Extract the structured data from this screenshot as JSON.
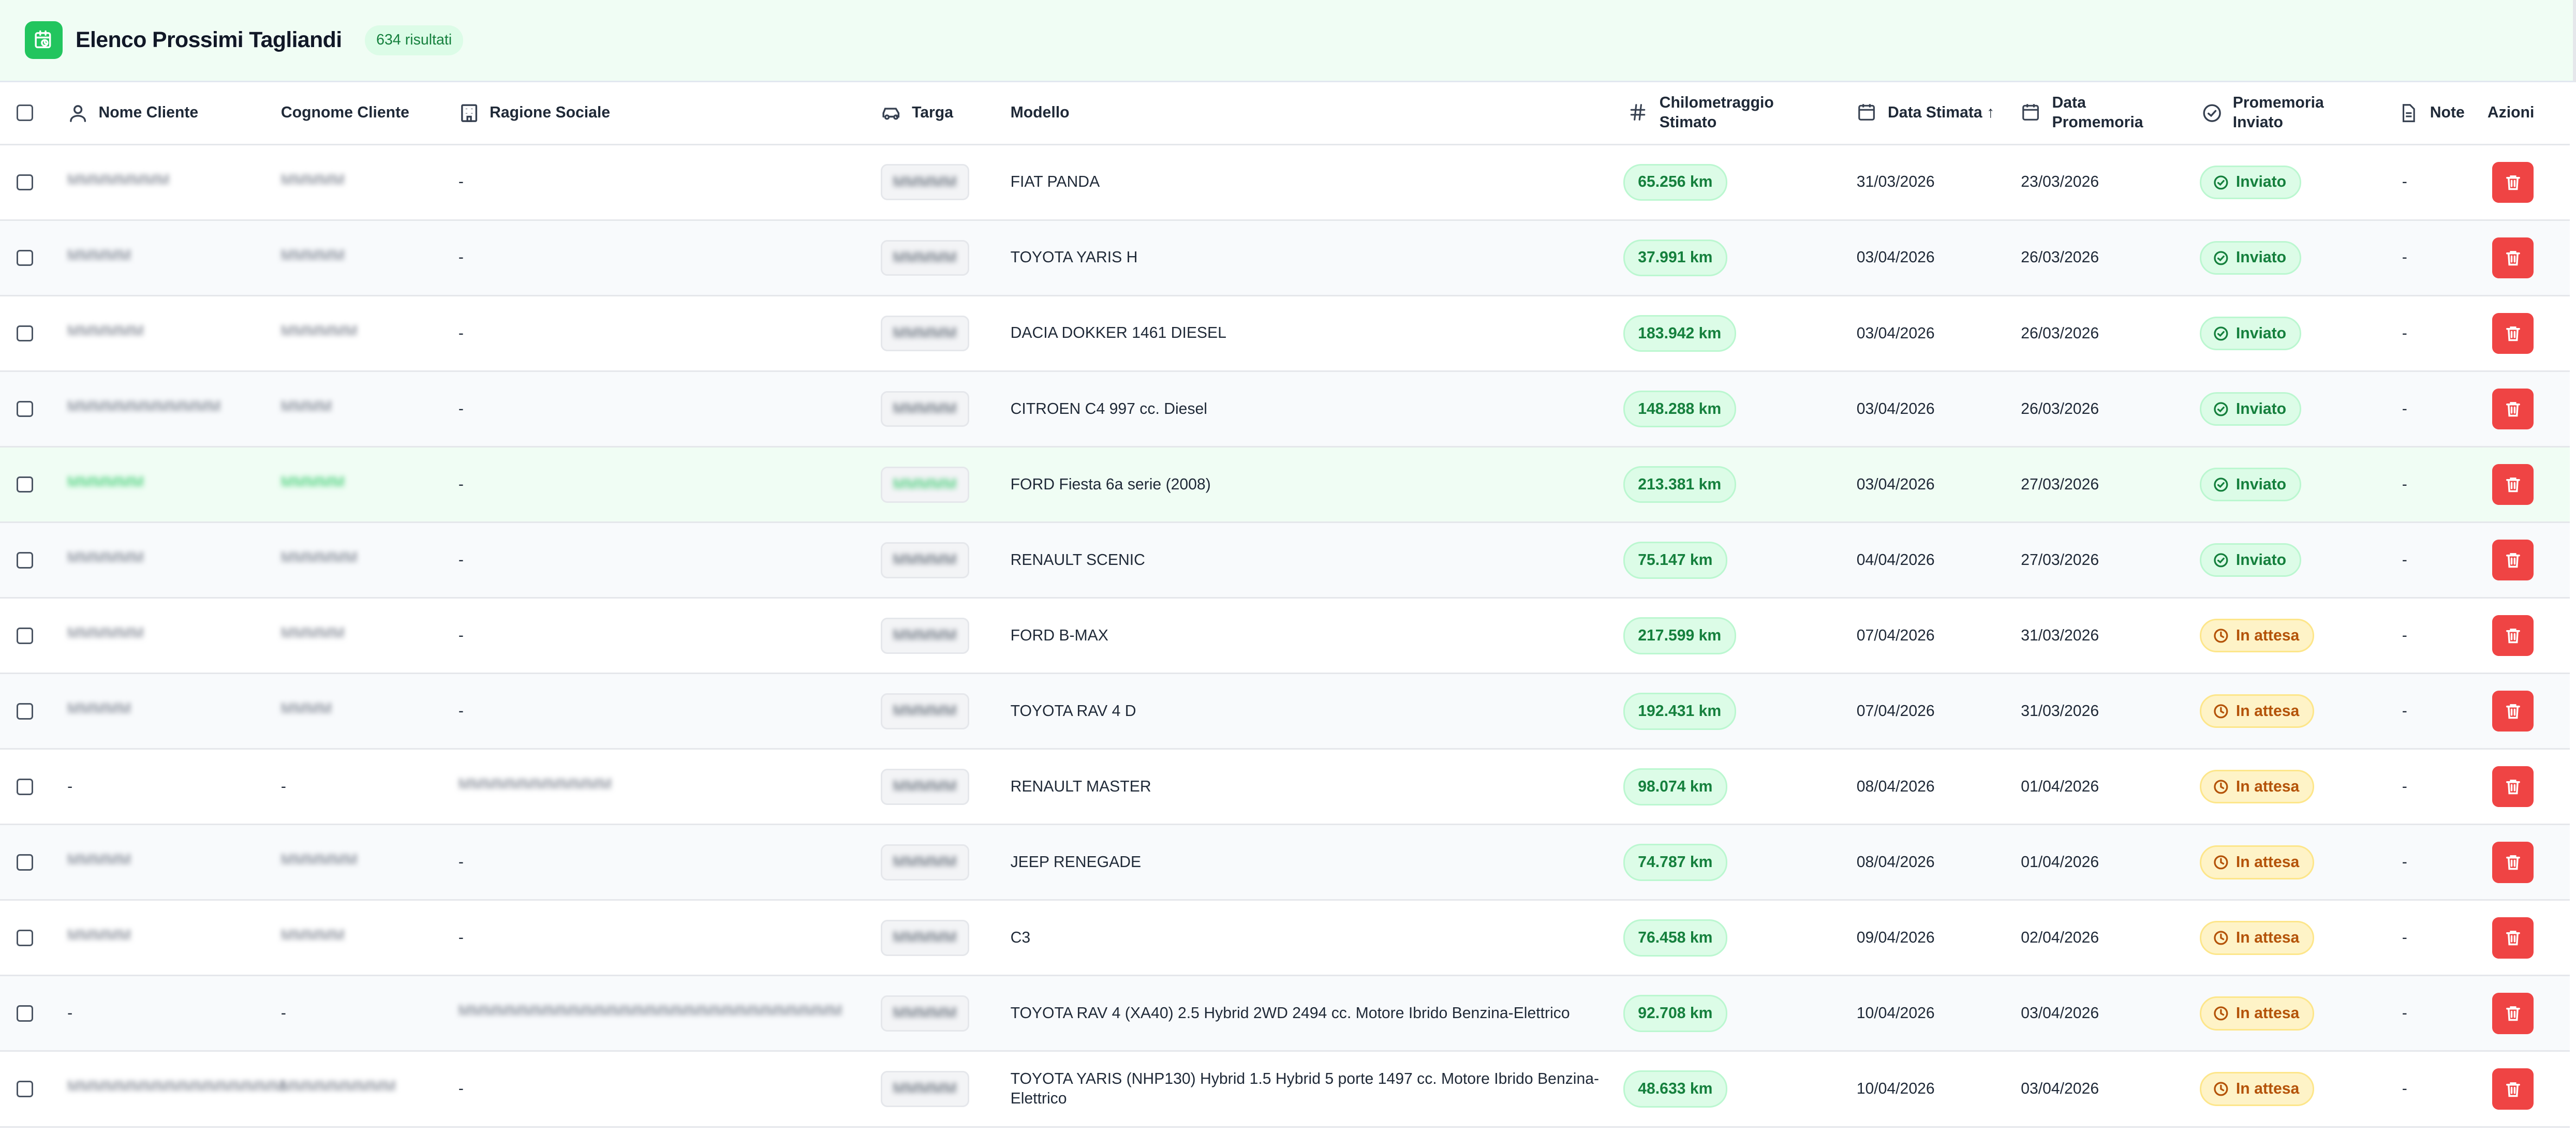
{
  "header": {
    "title": "Elenco Prossimi Tagliandi",
    "count": "634 risultati"
  },
  "icons": {
    "app": "calendar-clock-icon",
    "delete": "trash-icon",
    "sent": "check-circle-icon",
    "waiting": "clock-icon"
  },
  "colors": {
    "accent": "#22c55e",
    "km_badge_bg": "#dcfce7",
    "sent_badge_bg": "#dcfce7",
    "waiting_badge_bg": "#fef3c7",
    "delete_button": "#ef4444"
  },
  "columns": {
    "nome": "Nome Cliente",
    "cognome": "Cognome Cliente",
    "ragione": "Ragione Sociale",
    "targa": "Targa",
    "modello": "Modello",
    "km": "Chilometraggio Stimato",
    "data_stimata": "Data Stimata ↑",
    "data_promemoria": "Data Promemoria",
    "promemoria_inviato": "Promemoria Inviato",
    "note": "Note",
    "azioni": "Azioni"
  },
  "rows": [
    {
      "nome": "MMMMMMMM",
      "cognome": "MMMMM",
      "ragione": "-",
      "targa": "MMMMM",
      "modello": "FIAT PANDA",
      "km": "65.256 km",
      "data_stimata": "31/03/2026",
      "data_promemoria": "23/03/2026",
      "stato": "Inviato",
      "note": "-"
    },
    {
      "nome": "MMMMM",
      "cognome": "MMMMM",
      "ragione": "-",
      "targa": "MMMMM",
      "modello": "TOYOTA YARIS H",
      "km": "37.991 km",
      "data_stimata": "03/04/2026",
      "data_promemoria": "26/03/2026",
      "stato": "Inviato",
      "note": "-"
    },
    {
      "nome": "MMMMMM",
      "cognome": "MMMMMM",
      "ragione": "-",
      "targa": "MMMMM",
      "modello": "DACIA DOKKER 1461 DIESEL",
      "km": "183.942 km",
      "data_stimata": "03/04/2026",
      "data_promemoria": "26/03/2026",
      "stato": "Inviato",
      "note": "-"
    },
    {
      "nome": "MMMMMMMMMMMM",
      "cognome": "MMMM",
      "ragione": "-",
      "targa": "MMMMM",
      "modello": "CITROEN C4 997 cc. Diesel",
      "km": "148.288 km",
      "data_stimata": "03/04/2026",
      "data_promemoria": "26/03/2026",
      "stato": "Inviato",
      "note": "-"
    },
    {
      "nome": "MMMMMM",
      "cognome": "MMMMM",
      "ragione": "-",
      "targa": "MMMMM",
      "modello": "FORD Fiesta 6a serie (2008)",
      "km": "213.381 km",
      "data_stimata": "03/04/2026",
      "data_promemoria": "27/03/2026",
      "stato": "Inviato",
      "note": "-"
    },
    {
      "nome": "MMMMMM",
      "cognome": "MMMMMM",
      "ragione": "-",
      "targa": "MMMMM",
      "modello": "RENAULT SCENIC",
      "km": "75.147 km",
      "data_stimata": "04/04/2026",
      "data_promemoria": "27/03/2026",
      "stato": "Inviato",
      "note": "-"
    },
    {
      "nome": "MMMMMM",
      "cognome": "MMMMM",
      "ragione": "-",
      "targa": "MMMMM",
      "modello": "FORD B-MAX",
      "km": "217.599 km",
      "data_stimata": "07/04/2026",
      "data_promemoria": "31/03/2026",
      "stato": "In attesa",
      "note": "-"
    },
    {
      "nome": "MMMMM",
      "cognome": "MMMM",
      "ragione": "-",
      "targa": "MMMMM",
      "modello": "TOYOTA RAV 4 D",
      "km": "192.431 km",
      "data_stimata": "07/04/2026",
      "data_promemoria": "31/03/2026",
      "stato": "In attesa",
      "note": "-"
    },
    {
      "nome": "-",
      "cognome": "-",
      "ragione": "MMMMMMMMMMMM",
      "targa": "MMMMM",
      "modello": "RENAULT MASTER",
      "km": "98.074 km",
      "data_stimata": "08/04/2026",
      "data_promemoria": "01/04/2026",
      "stato": "In attesa",
      "note": "-"
    },
    {
      "nome": "MMMMM",
      "cognome": "MMMMMM",
      "ragione": "-",
      "targa": "MMMMM",
      "modello": "JEEP RENEGADE",
      "km": "74.787 km",
      "data_stimata": "08/04/2026",
      "data_promemoria": "01/04/2026",
      "stato": "In attesa",
      "note": "-"
    },
    {
      "nome": "MMMMM",
      "cognome": "MMMMM",
      "ragione": "-",
      "targa": "MMMMM",
      "modello": "C3",
      "km": "76.458 km",
      "data_stimata": "09/04/2026",
      "data_promemoria": "02/04/2026",
      "stato": "In attesa",
      "note": "-"
    },
    {
      "nome": "-",
      "cognome": "-",
      "ragione": "MMMMMMMMMMMMMMMMMMMMMMMMMMMMMM",
      "targa": "MMMMM",
      "modello": "TOYOTA RAV 4 (XA40) 2.5 Hybrid 2WD 2494 cc. Motore Ibrido Benzina-Elettrico",
      "km": "92.708 km",
      "data_stimata": "10/04/2026",
      "data_promemoria": "03/04/2026",
      "stato": "In attesa",
      "note": "-"
    },
    {
      "nome": "MMMMMMMMMMMMMMMMM",
      "cognome": "MMMMMMMMM",
      "ragione": "-",
      "targa": "MMMMM",
      "modello": "TOYOTA YARIS (NHP130) Hybrid 1.5 Hybrid 5 porte 1497 cc. Motore Ibrido Benzina-Elettrico",
      "km": "48.633 km",
      "data_stimata": "10/04/2026",
      "data_promemoria": "03/04/2026",
      "stato": "In attesa",
      "note": "-"
    }
  ]
}
